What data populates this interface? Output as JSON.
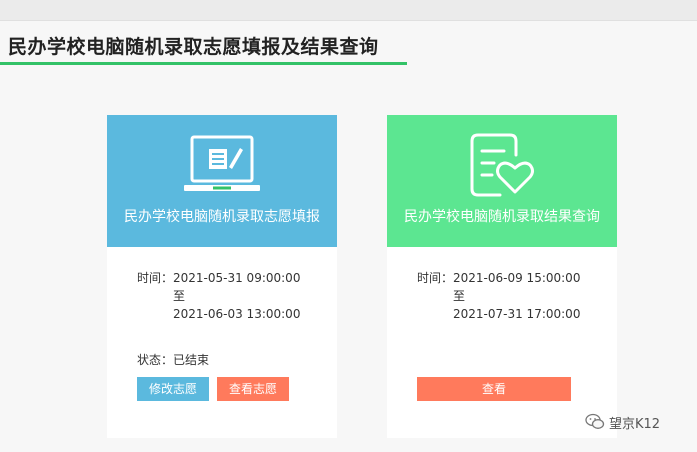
{
  "header": {
    "title": "民办学校电脑随机录取志愿填报及结果查询"
  },
  "cards": [
    {
      "name": "民办学校电脑随机录取志愿填报",
      "icon": "laptop-form-icon",
      "time_label": "时间：",
      "start": "2021-05-31 09:00:00",
      "separator": "至",
      "end": "2021-06-03 13:00:00",
      "status": "状态：已结束",
      "buttons": [
        "修改志愿",
        "查看志愿"
      ],
      "color": "#5bb9de"
    },
    {
      "name": "民办学校电脑随机录取结果查询",
      "icon": "document-heart-icon",
      "time_label": "时间：",
      "start": "2021-06-09 15:00:00",
      "separator": "至",
      "end": "2021-07-31 17:00:00",
      "buttons": [
        "查看"
      ],
      "color": "#5ce691"
    }
  ],
  "watermark": {
    "icon": "wechat-icon",
    "text": "望京K12"
  },
  "colors": {
    "button_orange": "#ff7a5c",
    "accent_green": "#33c267"
  }
}
